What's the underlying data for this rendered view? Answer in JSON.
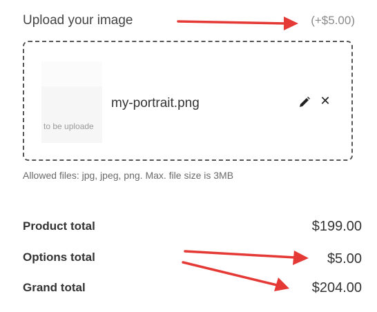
{
  "upload": {
    "label": "Upload your image",
    "price": "(+$5.00)",
    "file_name": "my-portrait.png",
    "thumbnail_text": "to be uploade",
    "allowed_files": "Allowed files: jpg, jpeg, png. Max. file size is 3MB"
  },
  "icons": {
    "edit": "pencil-icon",
    "remove": "close-icon",
    "remove_glyph": "✕"
  },
  "totals": {
    "product_label": "Product total",
    "product_value": "$199.00",
    "options_label": "Options total",
    "options_value": "$5.00",
    "grand_label": "Grand total",
    "grand_value": "$204.00"
  },
  "colors": {
    "annotation_arrow": "#e53935",
    "border": "#555555",
    "muted_text": "#8a8a8a"
  }
}
